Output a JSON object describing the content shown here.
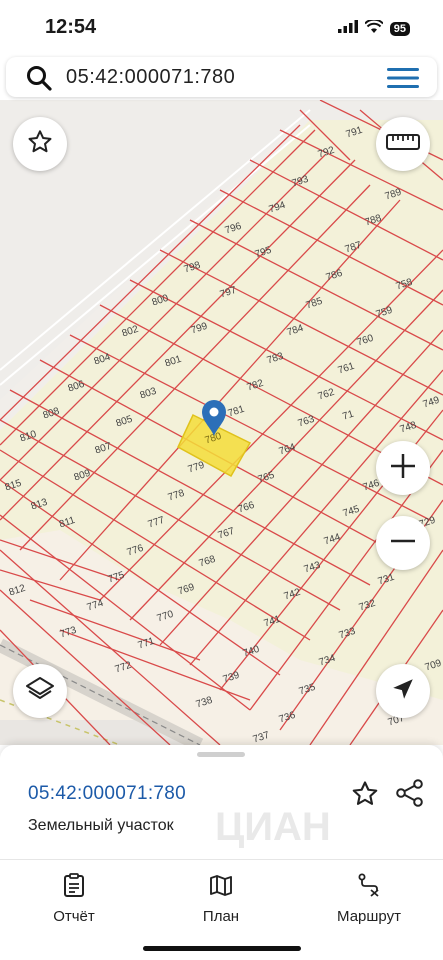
{
  "status": {
    "time": "12:54",
    "battery": "95"
  },
  "search": {
    "query": "05:42:000071:780"
  },
  "map": {
    "parcel_labels": [
      "791",
      "792",
      "793",
      "794",
      "795",
      "796",
      "797",
      "798",
      "799",
      "800",
      "801",
      "802",
      "803",
      "804",
      "805",
      "806",
      "807",
      "808",
      "809",
      "810",
      "811",
      "812",
      "813",
      "815",
      "781",
      "782",
      "783",
      "784",
      "785",
      "786",
      "787",
      "788",
      "789",
      "758",
      "759",
      "760",
      "761",
      "762",
      "763",
      "764",
      "765",
      "766",
      "767",
      "768",
      "769",
      "770",
      "771",
      "772",
      "773",
      "774",
      "775",
      "776",
      "777",
      "778",
      "779",
      "780",
      "71",
      "748",
      "749",
      "746",
      "745",
      "744",
      "743",
      "742",
      "741",
      "740",
      "739",
      "738",
      "737",
      "736",
      "735",
      "734",
      "733",
      "732",
      "731",
      "729",
      "709",
      "707"
    ],
    "selected_parcel": "780"
  },
  "sheet": {
    "cadastral_number": "05:42:000071:780",
    "type": "Земельный участок",
    "watermark": "ЦИАН"
  },
  "tabs": {
    "report": "Отчёт",
    "plan": "План",
    "route": "Маршрут"
  }
}
